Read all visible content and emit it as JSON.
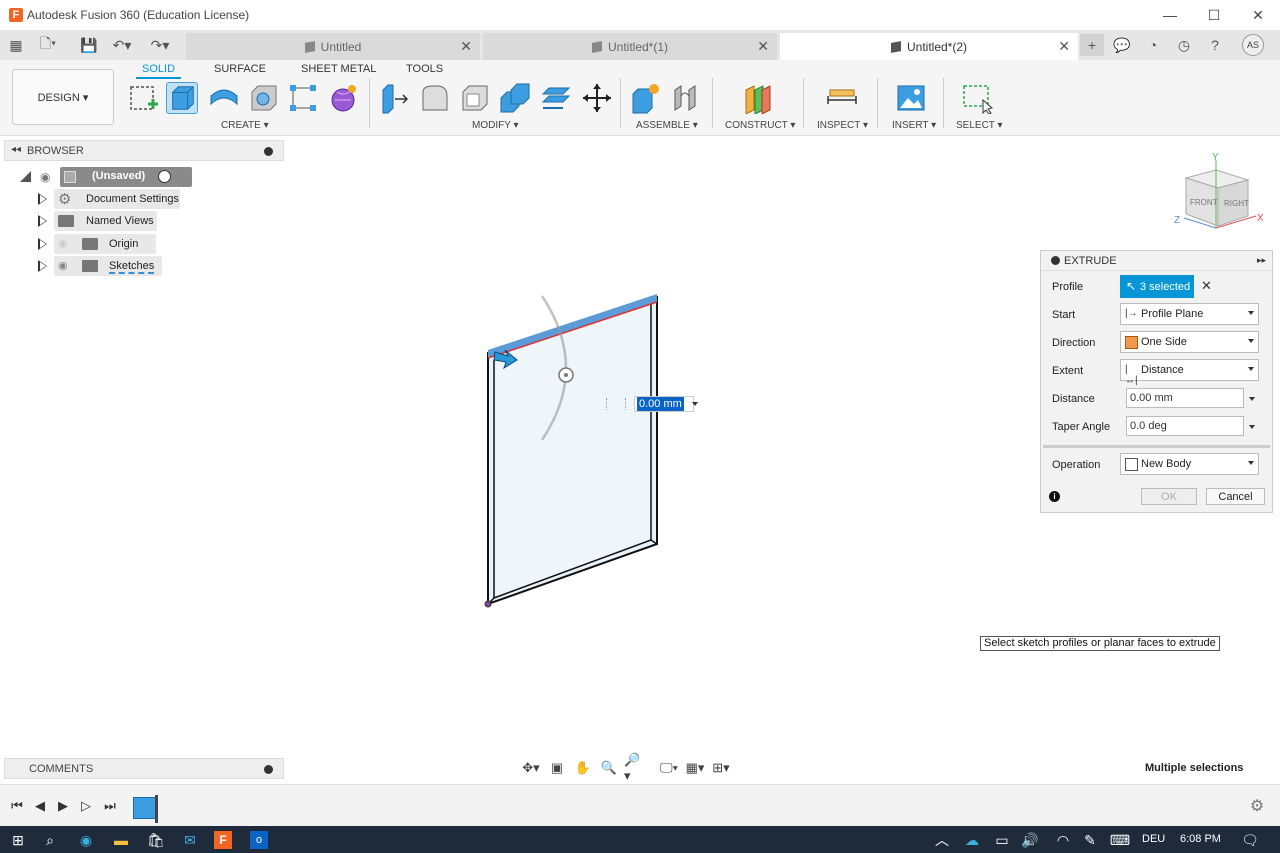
{
  "window": {
    "title": "Autodesk Fusion 360 (Education License)",
    "minimize": "—",
    "maximize": "☐",
    "close": "✕"
  },
  "tabs": [
    {
      "label": "Untitled",
      "active": false
    },
    {
      "label": "Untitled*(1)",
      "active": false
    },
    {
      "label": "Untitled*(2)",
      "active": true
    }
  ],
  "user": {
    "initials": "AS"
  },
  "toolbar": {
    "workspace": "DESIGN ▾",
    "tabs": [
      "SOLID",
      "SURFACE",
      "SHEET METAL",
      "TOOLS"
    ],
    "groups": [
      "CREATE ▾",
      "MODIFY ▾",
      "ASSEMBLE ▾",
      "CONSTRUCT ▾",
      "INSPECT ▾",
      "INSERT ▾",
      "SELECT ▾"
    ]
  },
  "browser": {
    "title": "BROWSER",
    "root": "(Unsaved)",
    "items": [
      "Document Settings",
      "Named Views",
      "Origin",
      "Sketches"
    ]
  },
  "comments": {
    "title": "COMMENTS"
  },
  "extrude": {
    "title": "EXTRUDE",
    "rows": {
      "profile_label": "Profile",
      "profile_value": "3 selected",
      "start_label": "Start",
      "start_value": "Profile Plane",
      "direction_label": "Direction",
      "direction_value": "One Side",
      "extent_label": "Extent",
      "extent_value": "Distance",
      "distance_label": "Distance",
      "distance_value": "0.00 mm",
      "taper_label": "Taper Angle",
      "taper_value": "0.0 deg",
      "operation_label": "Operation",
      "operation_value": "New Body"
    },
    "ok": "OK",
    "cancel": "Cancel"
  },
  "viewport": {
    "inline_distance": "0.00 mm",
    "hint": "Select sketch profiles or planar faces to extrude",
    "status": "Multiple selections",
    "viewcube": {
      "front": "FRONT",
      "right": "RIGHT",
      "axis_x": "X",
      "axis_y": "Y",
      "axis_z": "Z"
    }
  },
  "taskbar": {
    "lang": "DEU",
    "time": "6:08 PM"
  }
}
